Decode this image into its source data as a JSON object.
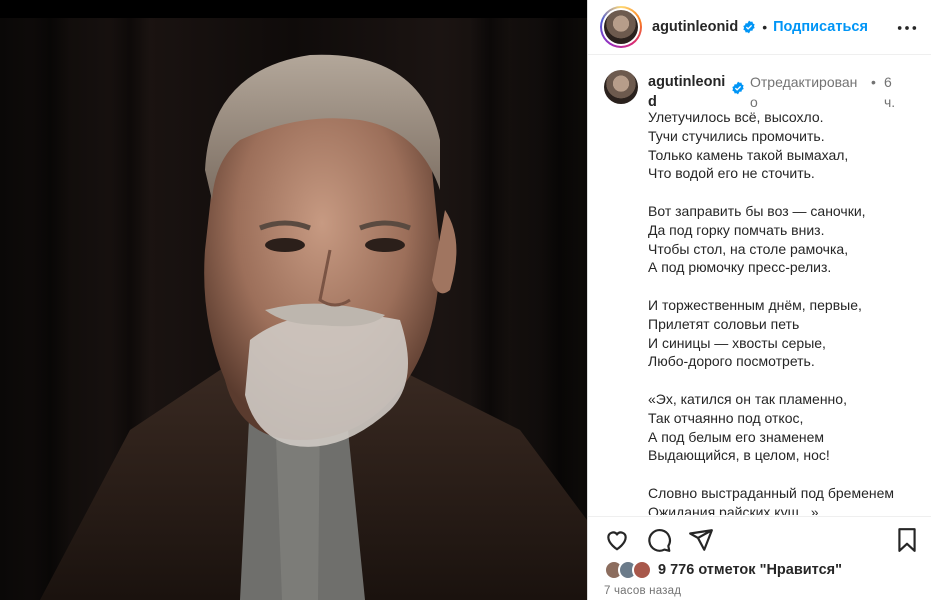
{
  "post": {
    "username": "agutinleonid",
    "username_wrapped": [
      "agutinleoni",
      "d"
    ],
    "follow_label": "Подписаться",
    "dot": "•",
    "edited_label_lines": [
      "Отредактирован",
      "о"
    ],
    "time_short_lines": [
      "6",
      "ч."
    ],
    "poem": [
      [
        "Улетучилось всё, высохло.",
        "Тучи стучились промочить.",
        "Только камень такой вымахал,",
        "Что водой его не сточить."
      ],
      [
        "Вот заправить бы воз — саночки,",
        "Да под горку помчать вниз.",
        "Чтобы стол, на столе рамочка,",
        "А под рюмочку пресс-релиз."
      ],
      [
        "И торжественным днём, первые,",
        "Прилетят соловьи петь",
        "И синицы — хвосты серые,",
        "Любо-дорого посмотреть."
      ],
      [
        "«Эх, катился он так пламенно,",
        "Так отчаянно под откос,",
        "А под белым его знаменем",
        "Выдающийся, в целом, нос!"
      ],
      [
        "Словно выстраданный под бременем",
        "Ожидания райских кущ...»"
      ]
    ],
    "likes_text": "9 776 отметок \"Нравится\"",
    "time_ago": "7 часов назад"
  },
  "icons": {
    "header": [
      "verified-icon",
      "more-options-icon"
    ],
    "actions": [
      "heart-icon",
      "comment-icon",
      "share-icon",
      "bookmark-icon"
    ]
  },
  "colors": {
    "accent": "#0095f6",
    "verified": "#0095f6",
    "text": "#262626",
    "muted": "#737373",
    "border": "#dbdbdb"
  }
}
